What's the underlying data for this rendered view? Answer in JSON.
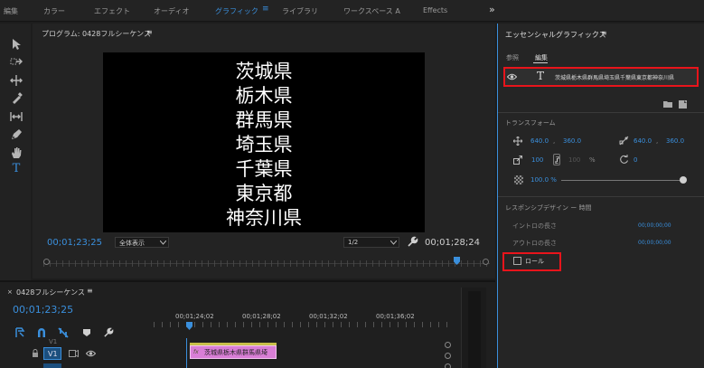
{
  "workspace_tabs": [
    {
      "label": "編集",
      "active": false
    },
    {
      "label": "カラー",
      "active": false
    },
    {
      "label": "エフェクト",
      "active": false
    },
    {
      "label": "オーディオ",
      "active": false
    },
    {
      "label": "グラフィック",
      "active": true
    },
    {
      "label": "ライブラリ",
      "active": false
    },
    {
      "label": "ワークスペース A",
      "active": false
    },
    {
      "label": "Effects",
      "active": false
    }
  ],
  "workspace_more": "»",
  "program": {
    "title": "プログラム: 0428フルシーケンス",
    "menu_icon": "≡",
    "prefectures": [
      "茨城県",
      "栃木県",
      "群馬県",
      "埼玉県",
      "千葉県",
      "東京都",
      "神奈川県"
    ],
    "timecode_current": "00;01;23;25",
    "zoom": "全体表示",
    "resolution": "1/2",
    "timecode_duration": "00;01;28;24"
  },
  "timeline": {
    "title": "0428フルシーケンス",
    "close": "×",
    "menu_icon": "≡",
    "timecode": "00;01;23;25",
    "ruler": [
      "00;01;24;02",
      "00;01;28;02",
      "00;01;32;02",
      "00;01;36;02"
    ],
    "track_label": "V1",
    "track_label_above": "V1",
    "clip_label": "茨城県栃木県群馬県埼"
  },
  "essential_graphics": {
    "title": "エッセンシャルグラフィックス",
    "menu_icon": "≡",
    "tabs": [
      {
        "label": "参照",
        "active": false
      },
      {
        "label": "編集",
        "active": true
      }
    ],
    "layer_name": "茨城県栃木県群馬県埼玉県千葉県東京都神奈川県",
    "transform_header": "トランスフォーム",
    "position_x": "640.0",
    "position_y": "360.0",
    "anchor_x": "640.0",
    "anchor_y": "360.0",
    "scale": "100",
    "scale_w": "100",
    "percent": "%",
    "rotation": "0",
    "opacity": "100.0 %",
    "responsive_header": "レスポンシブデザイン ー 時間",
    "intro_label": "イントロの長さ",
    "intro_value": "00;00;00;00",
    "outro_label": "アウトロの長さ",
    "outro_value": "00;00;00;00",
    "roll_label": "ロール"
  },
  "colors": {
    "accent": "#3a8fdc",
    "highlight": "#e8141b",
    "clip": "#d97ed6",
    "panel": "#232323"
  }
}
